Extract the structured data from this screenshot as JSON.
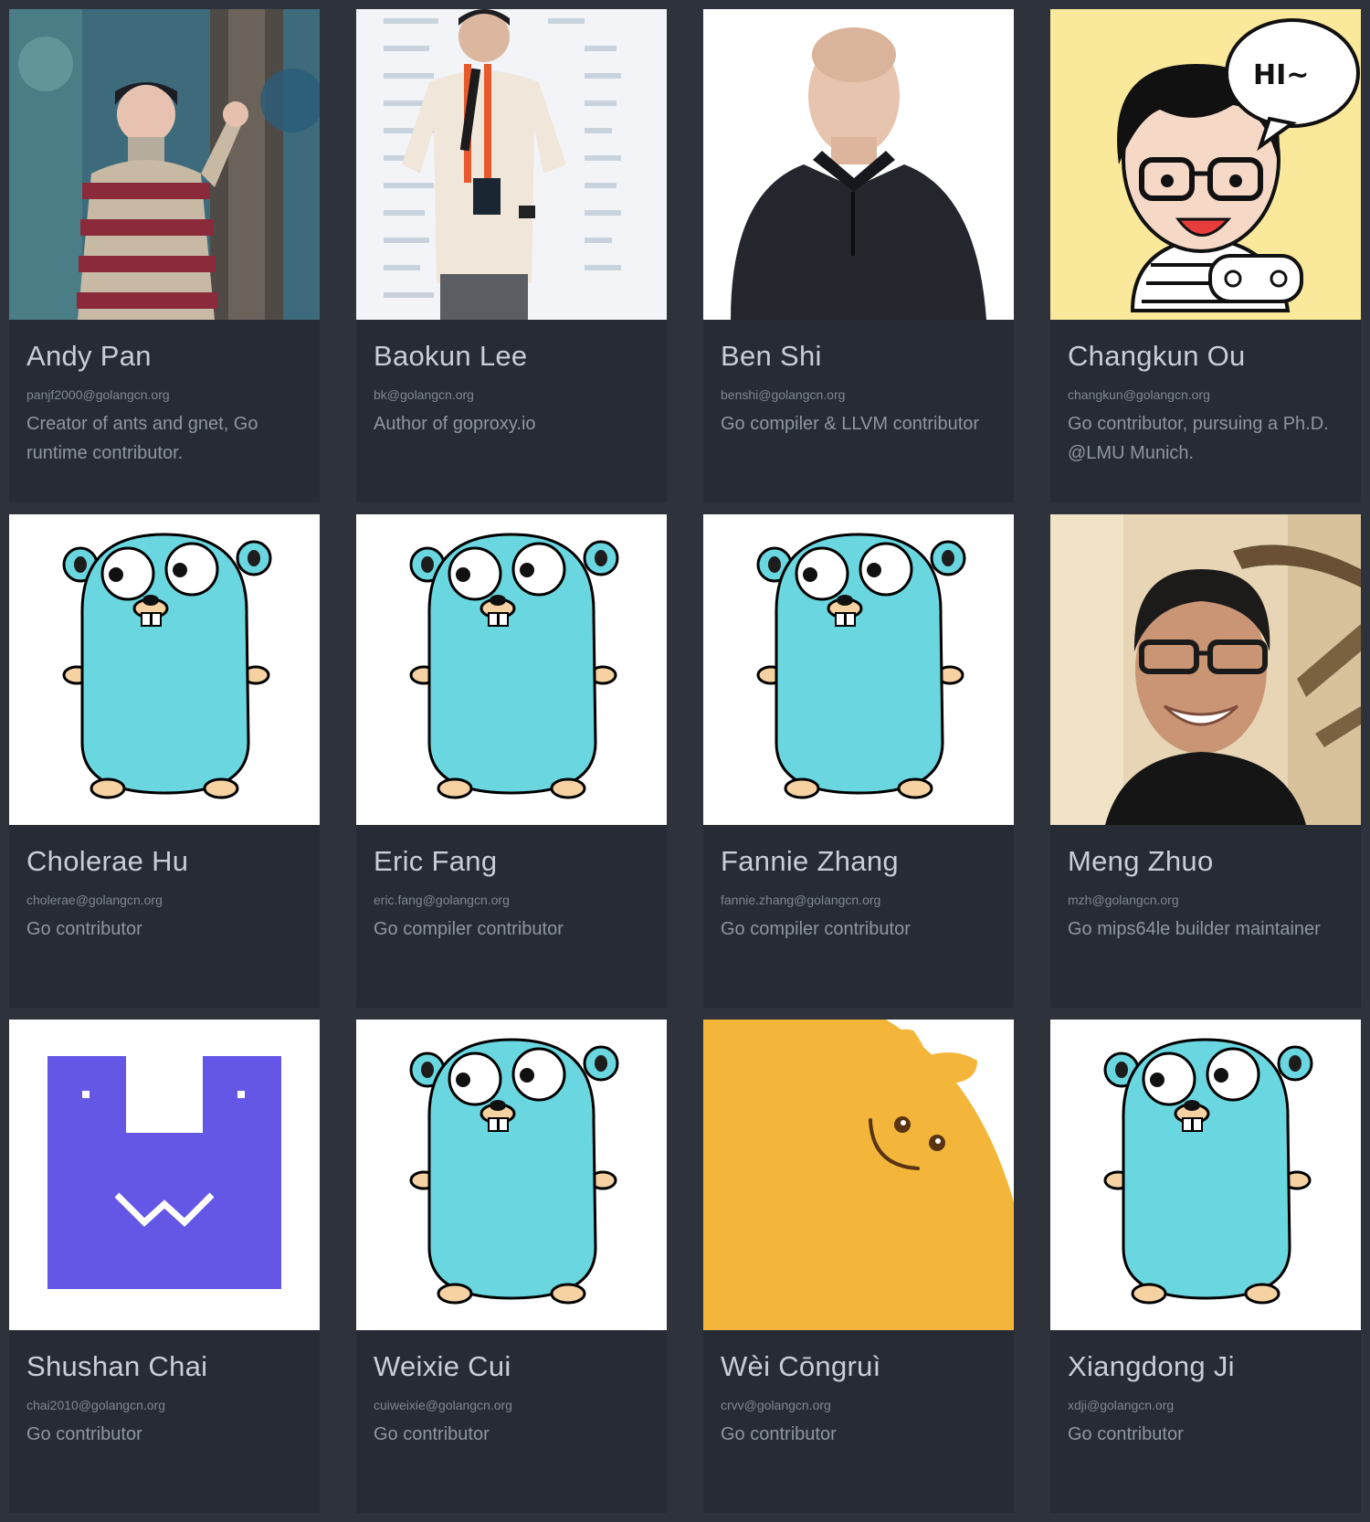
{
  "members": [
    {
      "name": "Andy Pan",
      "email": "panjf2000@golangcn.org",
      "bio": "Creator of ants and gnet, Go runtime contributor.",
      "avatar": "photo-striped-sweater"
    },
    {
      "name": "Baokun Lee",
      "email": "bk@golangcn.org",
      "bio": "Author of goproxy.io",
      "avatar": "photo-speaker-microphone"
    },
    {
      "name": "Ben Shi",
      "email": "benshi@golangcn.org",
      "bio": "Go compiler & LLVM contributor",
      "avatar": "photo-portrait-polo"
    },
    {
      "name": "Changkun Ou",
      "email": "changkun@golangcn.org",
      "bio": "Go contributor, pursuing a Ph.D. @LMU Munich.",
      "avatar": "cartoon-glasses-hi",
      "bubble_text": "HI~"
    },
    {
      "name": "Cholerae Hu",
      "email": "cholerae@golangcn.org",
      "bio": "Go contributor",
      "avatar": "gopher-mascot"
    },
    {
      "name": "Eric Fang",
      "email": "eric.fang@golangcn.org",
      "bio": "Go compiler contributor",
      "avatar": "gopher-mascot"
    },
    {
      "name": "Fannie Zhang",
      "email": "fannie.zhang@golangcn.org",
      "bio": "Go compiler contributor",
      "avatar": "gopher-mascot"
    },
    {
      "name": "Meng Zhuo",
      "email": "mzh@golangcn.org",
      "bio": "Go mips64le builder maintainer",
      "avatar": "photo-smiling-glasses"
    },
    {
      "name": "Shushan Chai",
      "email": "chai2010@golangcn.org",
      "bio": "Go contributor",
      "avatar": "purple-block-face"
    },
    {
      "name": "Weixie Cui",
      "email": "cuiweixie@golangcn.org",
      "bio": "Go contributor",
      "avatar": "gopher-mascot"
    },
    {
      "name": "Wèi Cōngruì",
      "email": "crvv@golangcn.org",
      "bio": "Go contributor",
      "avatar": "orange-blob-face"
    },
    {
      "name": "Xiangdong Ji",
      "email": "xdji@golangcn.org",
      "bio": "Go contributor",
      "avatar": "gopher-mascot"
    }
  ],
  "colors": {
    "page_background": "#2e333b",
    "card_background": "#272b33",
    "name_text": "#c9ced6",
    "email_text": "#7f8794",
    "bio_text": "#8e96a2",
    "gopher_blue": "#6ad7e0",
    "purple_block": "#6457e6",
    "orange_blob": "#f3b63a"
  }
}
